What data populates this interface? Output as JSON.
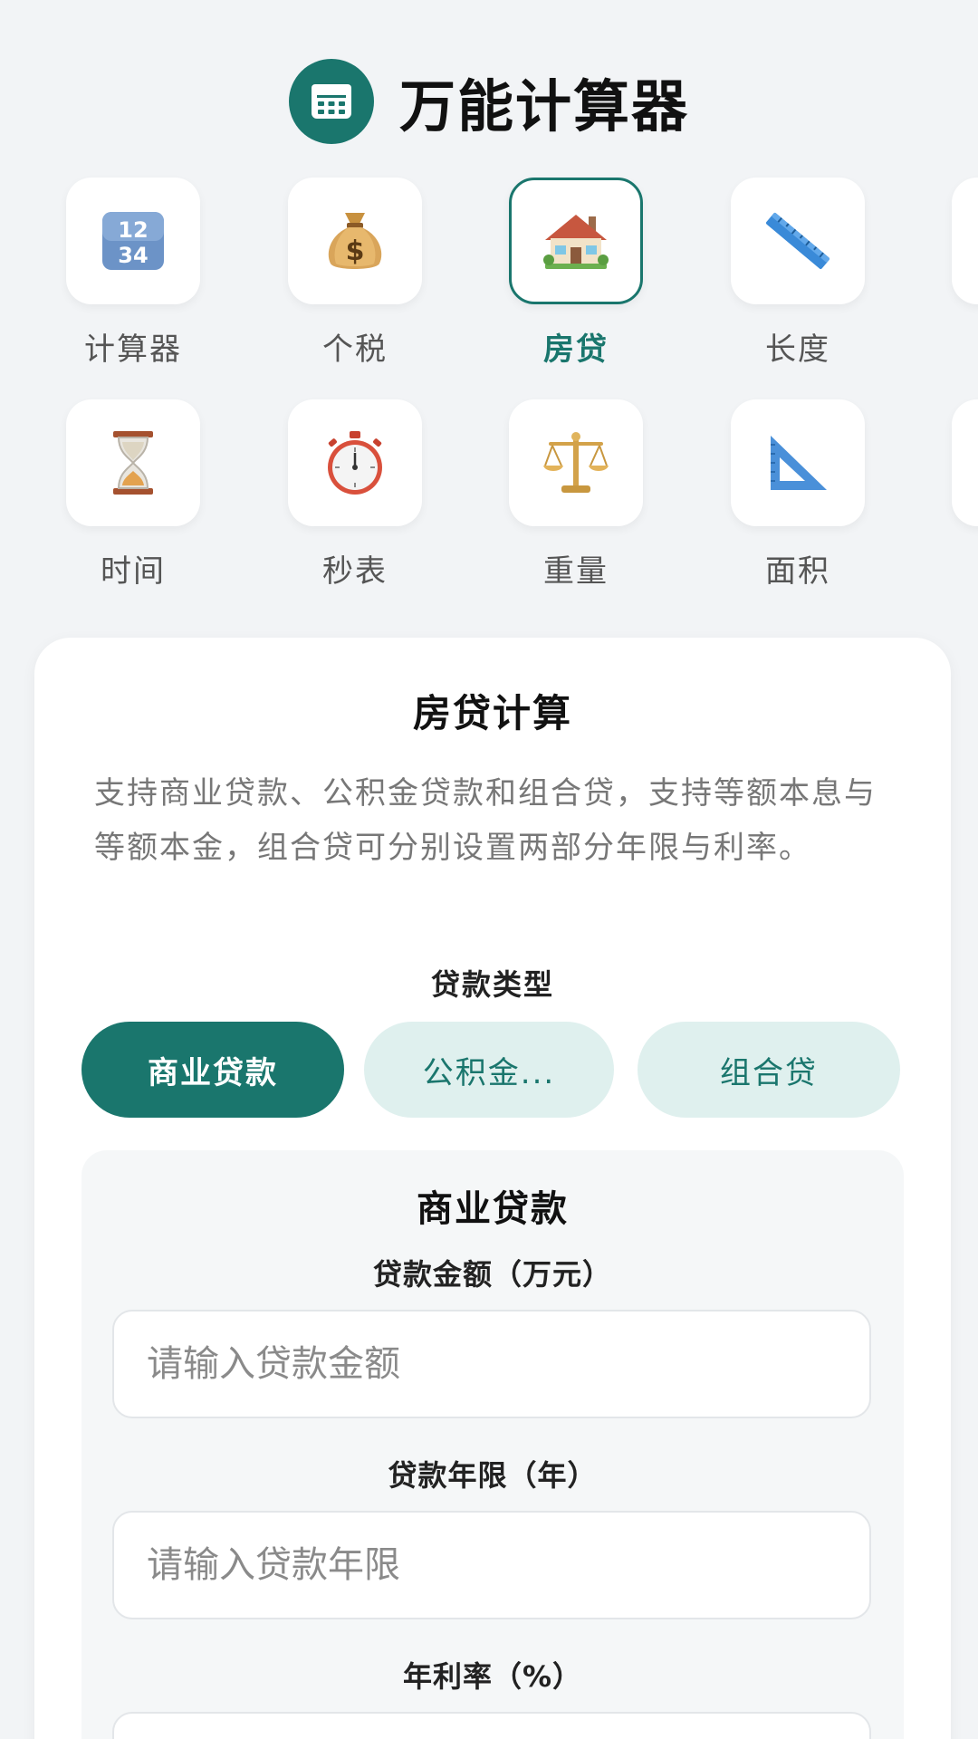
{
  "header": {
    "title": "万能计算器",
    "logo_icon": "calculator-icon"
  },
  "tools": [
    {
      "label": "计算器",
      "icon": "numbers-1234-icon",
      "active": false
    },
    {
      "label": "个税",
      "icon": "money-bag-icon",
      "active": false
    },
    {
      "label": "房贷",
      "icon": "house-icon",
      "active": true
    },
    {
      "label": "长度",
      "icon": "ruler-icon",
      "active": false
    },
    {
      "label": "时间",
      "icon": "hourglass-icon",
      "active": false
    },
    {
      "label": "秒表",
      "icon": "stopwatch-icon",
      "active": false
    },
    {
      "label": "重量",
      "icon": "balance-scale-icon",
      "active": false
    },
    {
      "label": "面积",
      "icon": "triangle-ruler-icon",
      "active": false
    }
  ],
  "card": {
    "title": "房贷计算",
    "description": "支持商业贷款、公积金贷款和组合贷，支持等额本息与等额本金，组合贷可分别设置两部分年限与利率。",
    "loan_type_label": "贷款类型",
    "loan_types": [
      {
        "label": "商业贷款",
        "selected": true
      },
      {
        "label": "公积金...",
        "selected": false
      },
      {
        "label": "组合贷",
        "selected": false
      }
    ],
    "section": {
      "title": "商业贷款",
      "amount_label": "贷款金额（万元）",
      "amount_placeholder": "请输入贷款金额",
      "amount_value": "",
      "years_label": "贷款年限（年）",
      "years_placeholder": "请输入贷款年限",
      "years_value": "",
      "rate_label": "年利率（%）"
    }
  },
  "colors": {
    "accent": "#1a766d",
    "accent_light": "#dff0ee",
    "background": "#f2f4f6"
  }
}
